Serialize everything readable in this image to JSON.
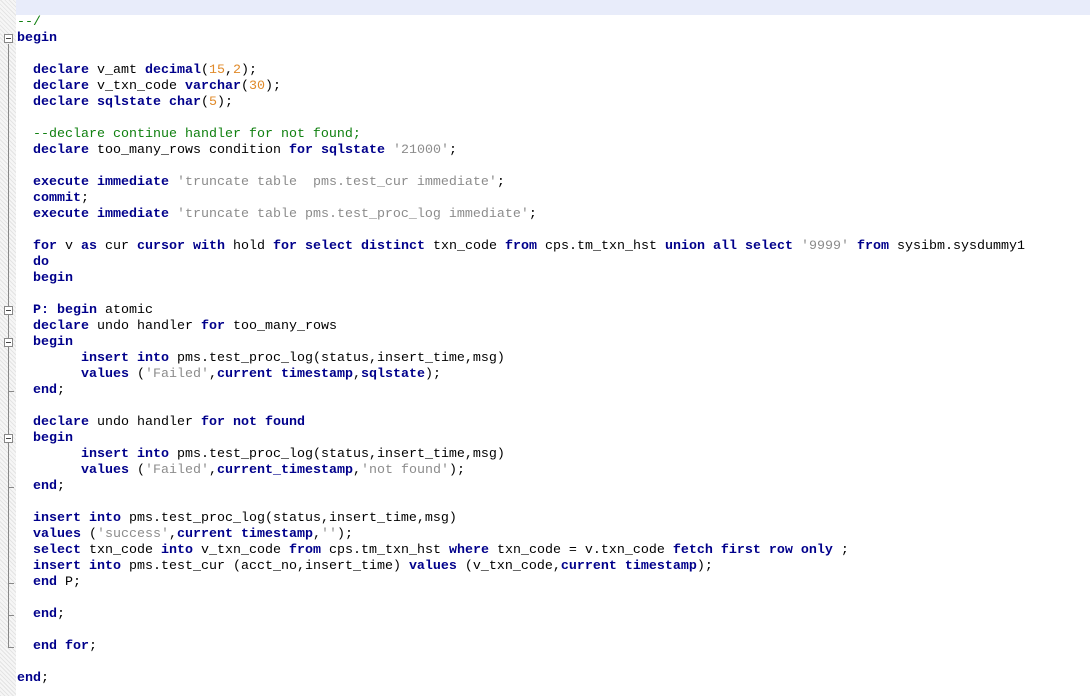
{
  "editor": {
    "language": "sql",
    "colors": {
      "keyword": "#00008b",
      "string": "#8c8c8c",
      "number": "#e08a2a",
      "comment": "#108010",
      "current_line": "#e8ecfa"
    },
    "lines": [
      [
        [
          "c",
          "--/"
        ]
      ],
      [
        [
          "k",
          "begin"
        ]
      ],
      [],
      [
        [
          "p",
          "  "
        ],
        [
          "k",
          "declare"
        ],
        [
          "p",
          " v_amt "
        ],
        [
          "k",
          "decimal"
        ],
        [
          "p",
          "("
        ],
        [
          "n",
          "15"
        ],
        [
          "p",
          ","
        ],
        [
          "n",
          "2"
        ],
        [
          "p",
          ");"
        ]
      ],
      [
        [
          "p",
          "  "
        ],
        [
          "k",
          "declare"
        ],
        [
          "p",
          " v_txn_code "
        ],
        [
          "k",
          "varchar"
        ],
        [
          "p",
          "("
        ],
        [
          "n",
          "30"
        ],
        [
          "p",
          ");"
        ]
      ],
      [
        [
          "p",
          "  "
        ],
        [
          "k",
          "declare"
        ],
        [
          "p",
          " "
        ],
        [
          "k",
          "sqlstate"
        ],
        [
          "p",
          " "
        ],
        [
          "k",
          "char"
        ],
        [
          "p",
          "("
        ],
        [
          "n",
          "5"
        ],
        [
          "p",
          ");"
        ]
      ],
      [],
      [
        [
          "p",
          "  "
        ],
        [
          "c",
          "--declare continue handler for not found;"
        ]
      ],
      [
        [
          "p",
          "  "
        ],
        [
          "k",
          "declare"
        ],
        [
          "p",
          " too_many_rows condition "
        ],
        [
          "k",
          "for"
        ],
        [
          "p",
          " "
        ],
        [
          "k",
          "sqlstate"
        ],
        [
          "p",
          " "
        ],
        [
          "s",
          "'21000'"
        ],
        [
          "p",
          ";"
        ]
      ],
      [],
      [
        [
          "p",
          "  "
        ],
        [
          "k",
          "execute"
        ],
        [
          "p",
          " "
        ],
        [
          "k",
          "immediate"
        ],
        [
          "p",
          " "
        ],
        [
          "s",
          "'truncate table  pms.test_cur immediate'"
        ],
        [
          "p",
          ";"
        ]
      ],
      [
        [
          "p",
          "  "
        ],
        [
          "k",
          "commit"
        ],
        [
          "p",
          ";"
        ]
      ],
      [
        [
          "p",
          "  "
        ],
        [
          "k",
          "execute"
        ],
        [
          "p",
          " "
        ],
        [
          "k",
          "immediate"
        ],
        [
          "p",
          " "
        ],
        [
          "s",
          "'truncate table pms.test_proc_log immediate'"
        ],
        [
          "p",
          ";"
        ]
      ],
      [],
      [
        [
          "p",
          "  "
        ],
        [
          "k",
          "for"
        ],
        [
          "p",
          " v "
        ],
        [
          "k",
          "as"
        ],
        [
          "p",
          " cur "
        ],
        [
          "k",
          "cursor"
        ],
        [
          "p",
          " "
        ],
        [
          "k",
          "with"
        ],
        [
          "p",
          " hold "
        ],
        [
          "k",
          "for"
        ],
        [
          "p",
          " "
        ],
        [
          "k",
          "select"
        ],
        [
          "p",
          " "
        ],
        [
          "k",
          "distinct"
        ],
        [
          "p",
          " txn_code "
        ],
        [
          "k",
          "from"
        ],
        [
          "p",
          " cps.tm_txn_hst "
        ],
        [
          "k",
          "union"
        ],
        [
          "p",
          " "
        ],
        [
          "k",
          "all"
        ],
        [
          "p",
          " "
        ],
        [
          "k",
          "select"
        ],
        [
          "p",
          " "
        ],
        [
          "s",
          "'9999'"
        ],
        [
          "p",
          " "
        ],
        [
          "k",
          "from"
        ],
        [
          "p",
          " sysibm.sysdummy1"
        ]
      ],
      [
        [
          "p",
          "  "
        ],
        [
          "k",
          "do"
        ]
      ],
      [
        [
          "p",
          "  "
        ],
        [
          "k",
          "begin"
        ]
      ],
      [],
      [
        [
          "p",
          "  "
        ],
        [
          "k",
          "P:"
        ],
        [
          "p",
          " "
        ],
        [
          "k",
          "begin"
        ],
        [
          "p",
          " atomic"
        ]
      ],
      [
        [
          "p",
          "  "
        ],
        [
          "k",
          "declare"
        ],
        [
          "p",
          " undo handler "
        ],
        [
          "k",
          "for"
        ],
        [
          "p",
          " too_many_rows"
        ]
      ],
      [
        [
          "p",
          "  "
        ],
        [
          "k",
          "begin"
        ]
      ],
      [
        [
          "p",
          "        "
        ],
        [
          "k",
          "insert"
        ],
        [
          "p",
          " "
        ],
        [
          "k",
          "into"
        ],
        [
          "p",
          " pms.test_proc_log(status,insert_time,msg)"
        ]
      ],
      [
        [
          "p",
          "        "
        ],
        [
          "k",
          "values"
        ],
        [
          "p",
          " ("
        ],
        [
          "s",
          "'Failed'"
        ],
        [
          "p",
          ","
        ],
        [
          "k",
          "current"
        ],
        [
          "p",
          " "
        ],
        [
          "k",
          "timestamp"
        ],
        [
          "p",
          ","
        ],
        [
          "k",
          "sqlstate"
        ],
        [
          "p",
          ");"
        ]
      ],
      [
        [
          "p",
          "  "
        ],
        [
          "k",
          "end"
        ],
        [
          "p",
          ";"
        ]
      ],
      [],
      [
        [
          "p",
          "  "
        ],
        [
          "k",
          "declare"
        ],
        [
          "p",
          " undo handler "
        ],
        [
          "k",
          "for"
        ],
        [
          "p",
          " "
        ],
        [
          "k",
          "not"
        ],
        [
          "p",
          " "
        ],
        [
          "k",
          "found"
        ]
      ],
      [
        [
          "p",
          "  "
        ],
        [
          "k",
          "begin"
        ]
      ],
      [
        [
          "p",
          "        "
        ],
        [
          "k",
          "insert"
        ],
        [
          "p",
          " "
        ],
        [
          "k",
          "into"
        ],
        [
          "p",
          " pms.test_proc_log(status,insert_time,msg)"
        ]
      ],
      [
        [
          "p",
          "        "
        ],
        [
          "k",
          "values"
        ],
        [
          "p",
          " ("
        ],
        [
          "s",
          "'Failed'"
        ],
        [
          "p",
          ","
        ],
        [
          "k",
          "current_timestamp"
        ],
        [
          "p",
          ","
        ],
        [
          "s",
          "'not found'"
        ],
        [
          "p",
          ");"
        ]
      ],
      [
        [
          "p",
          "  "
        ],
        [
          "k",
          "end"
        ],
        [
          "p",
          ";"
        ]
      ],
      [],
      [
        [
          "p",
          "  "
        ],
        [
          "k",
          "insert"
        ],
        [
          "p",
          " "
        ],
        [
          "k",
          "into"
        ],
        [
          "p",
          " pms.test_proc_log(status,insert_time,msg)"
        ]
      ],
      [
        [
          "p",
          "  "
        ],
        [
          "k",
          "values"
        ],
        [
          "p",
          " ("
        ],
        [
          "s",
          "'success'"
        ],
        [
          "p",
          ","
        ],
        [
          "k",
          "current"
        ],
        [
          "p",
          " "
        ],
        [
          "k",
          "timestamp"
        ],
        [
          "p",
          ","
        ],
        [
          "s",
          "''"
        ],
        [
          "p",
          ");"
        ]
      ],
      [
        [
          "p",
          "  "
        ],
        [
          "k",
          "select"
        ],
        [
          "p",
          " txn_code "
        ],
        [
          "k",
          "into"
        ],
        [
          "p",
          " v_txn_code "
        ],
        [
          "k",
          "from"
        ],
        [
          "p",
          " cps.tm_txn_hst "
        ],
        [
          "k",
          "where"
        ],
        [
          "p",
          " txn_code = v.txn_code "
        ],
        [
          "k",
          "fetch"
        ],
        [
          "p",
          " "
        ],
        [
          "k",
          "first"
        ],
        [
          "p",
          " "
        ],
        [
          "k",
          "row"
        ],
        [
          "p",
          " "
        ],
        [
          "k",
          "only"
        ],
        [
          "p",
          " ;"
        ]
      ],
      [
        [
          "p",
          "  "
        ],
        [
          "k",
          "insert"
        ],
        [
          "p",
          " "
        ],
        [
          "k",
          "into"
        ],
        [
          "p",
          " pms.test_cur (acct_no,insert_time) "
        ],
        [
          "k",
          "values"
        ],
        [
          "p",
          " (v_txn_code,"
        ],
        [
          "k",
          "current"
        ],
        [
          "p",
          " "
        ],
        [
          "k",
          "timestamp"
        ],
        [
          "p",
          ");"
        ]
      ],
      [
        [
          "p",
          "  "
        ],
        [
          "k",
          "end"
        ],
        [
          "p",
          " P;"
        ]
      ],
      [],
      [
        [
          "p",
          "  "
        ],
        [
          "k",
          "end"
        ],
        [
          "p",
          ";"
        ]
      ],
      [],
      [
        [
          "p",
          "  "
        ],
        [
          "k",
          "end"
        ],
        [
          "p",
          " "
        ],
        [
          "k",
          "for"
        ],
        [
          "p",
          ";"
        ]
      ],
      [],
      [
        [
          "k",
          "end"
        ],
        [
          "p",
          ";"
        ]
      ]
    ]
  }
}
